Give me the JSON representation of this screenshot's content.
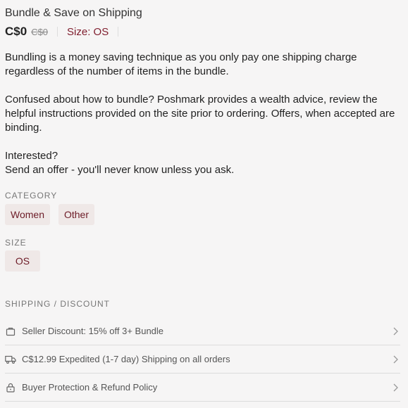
{
  "listing": {
    "title": "Bundle & Save on Shipping",
    "price": "C$0",
    "original_price": "C$0",
    "size_inline": "Size: OS"
  },
  "description": {
    "paragraphs": [
      "Bundling is a money saving technique as you only pay one shipping charge regardless of the number of items in the bundle.",
      "Confused about how to bundle? Poshmark provides a wealth advice, review the helpful instructions provided on the site prior to ordering.  Offers, when accepted are binding.",
      "Interested?",
      "Send an offer - you'll never know unless you ask."
    ]
  },
  "category": {
    "label": "CATEGORY",
    "chips": [
      "Women",
      "Other"
    ]
  },
  "size": {
    "label": "SIZE",
    "value": "OS"
  },
  "shipping": {
    "label": "SHIPPING / DISCOUNT",
    "rows": [
      {
        "icon": "bag-icon",
        "text": "Seller Discount: 15% off 3+ Bundle"
      },
      {
        "icon": "truck-icon",
        "text": "C$12.99 Expedited (1-7 day) Shipping on all orders"
      },
      {
        "icon": "lock-icon",
        "text": "Buyer Protection & Refund Policy"
      }
    ]
  },
  "colors": {
    "accent": "#7f1d2d",
    "chip_bg": "#efe8e7",
    "background": "#f6f5f5"
  }
}
